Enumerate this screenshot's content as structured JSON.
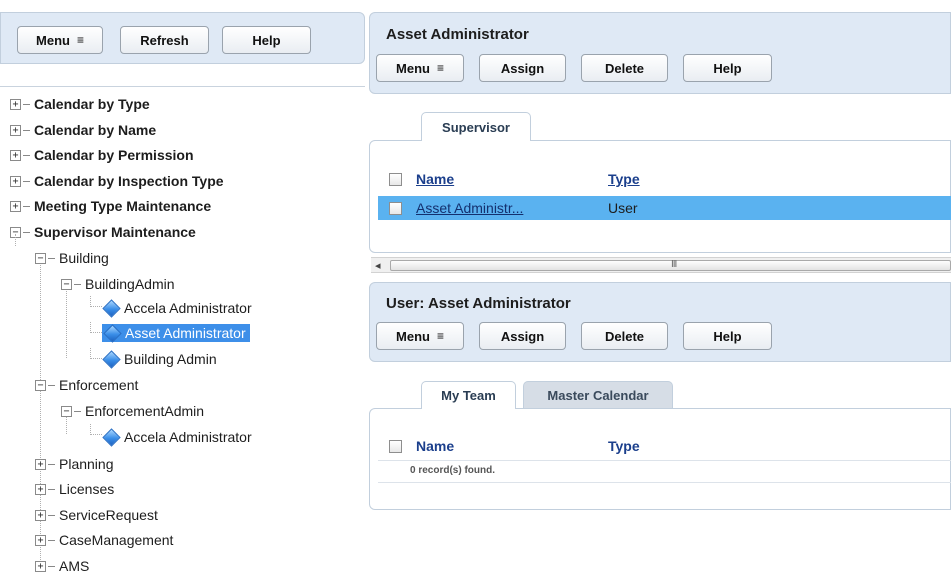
{
  "left": {
    "toolbar": {
      "menu": "Menu",
      "refresh": "Refresh",
      "help": "Help"
    },
    "tree": {
      "top_items": [
        "Calendar by Type",
        "Calendar by Name",
        "Calendar by Permission",
        "Calendar by Inspection Type",
        "Meeting Type Maintenance",
        "Supervisor Maintenance"
      ],
      "building": "Building",
      "building_admin": "BuildingAdmin",
      "building_admin_children": [
        "Accela Administrator",
        "Asset Administrator",
        "Building Admin"
      ],
      "enforcement": "Enforcement",
      "enforcement_admin": "EnforcementAdmin",
      "enforcement_admin_children": [
        "Accela Administrator"
      ],
      "modules": [
        "Planning",
        "Licenses",
        "ServiceRequest",
        "CaseManagement",
        "AMS"
      ]
    },
    "expander_plus": "+",
    "expander_minus": "−"
  },
  "top_section": {
    "title": "Asset Administrator",
    "toolbar": {
      "menu": "Menu",
      "assign": "Assign",
      "delete": "Delete",
      "help": "Help"
    },
    "tab": "Supervisor",
    "columns": {
      "name": "Name",
      "type": "Type"
    },
    "rows": [
      {
        "name": "Asset Administr...",
        "type": "User"
      }
    ]
  },
  "bottom_section": {
    "title": "User: Asset Administrator",
    "toolbar": {
      "menu": "Menu",
      "assign": "Assign",
      "delete": "Delete",
      "help": "Help"
    },
    "tabs": [
      "My Team",
      "Master Calendar"
    ],
    "columns": {
      "name": "Name",
      "type": "Type"
    },
    "record_count": "0 record(s) found."
  },
  "icons": {
    "menu_glyph": "≡",
    "scroll_left": "◂",
    "scroll_grip": "III"
  },
  "colors": {
    "panel_bg": "#dfe9f5",
    "selected_row": "#5ab2f0",
    "tree_selected": "#3d8fe9"
  }
}
